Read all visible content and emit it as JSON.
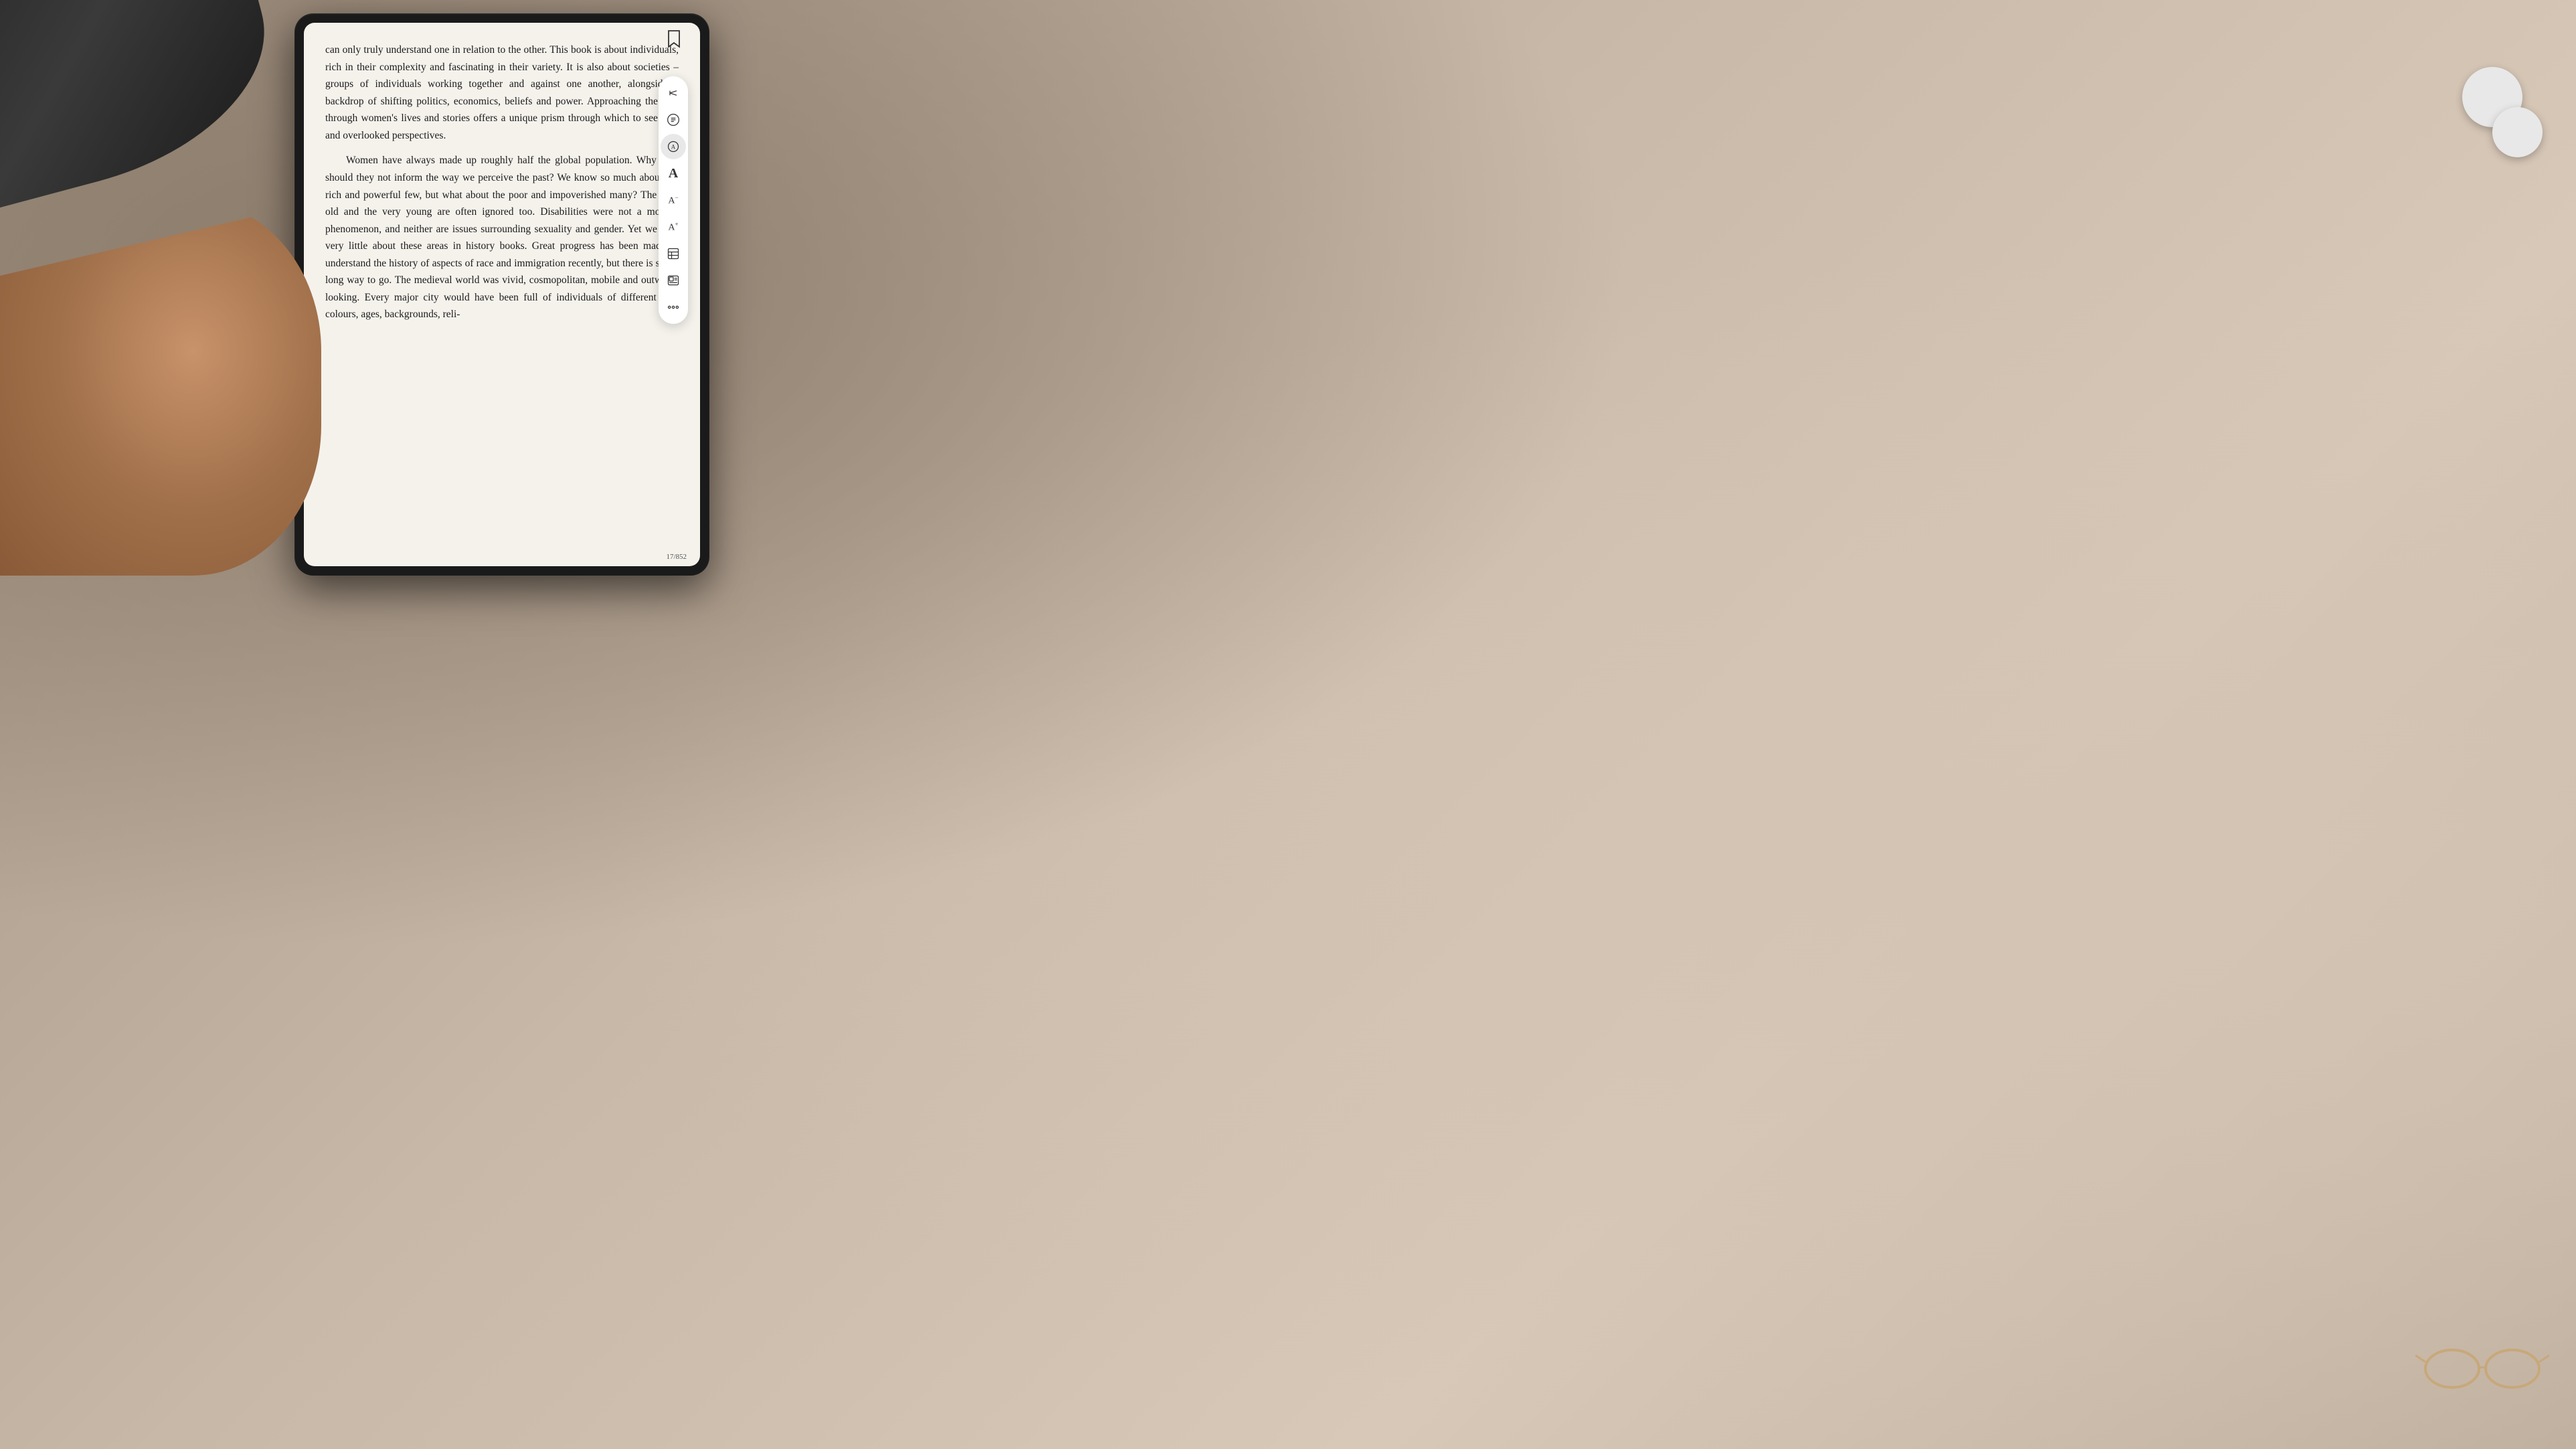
{
  "scene": {
    "background_color": "#c8b8a8"
  },
  "tablet": {
    "page_number": "17/852",
    "bookmark_visible": true
  },
  "book": {
    "paragraph1": "can only truly understand one in relation to the other. This book is about individuals, rich in their complexity and fascinating in their variety. It is also about societies – groups of individuals working together and against one another, alongside a backdrop of shifting politics, economics, beliefs and power. Approaching the past through women's lives and stories offers a unique prism through which to see new and overlooked perspectives.",
    "paragraph2": "Women have always made up roughly half the global population. Why then should they not inform the way we perceive the past? We know so much about the rich and powerful few, but what about the poor and impoverished many? The very old and the very young are often ignored too. Disabilities were not a modern phenomenon, and neither are issues surrounding sexuality and gender. Yet we read very little about these areas in history books. Great progress has been made to understand the history of aspects of race and immigration recently, but there is still a long way to go. The medieval world was vivid, cosmopolitan, mobile and outward-looking. Every major city would have been full of individuals of different skin colours, ages, backgrounds, reli-"
  },
  "toolbar": {
    "items": [
      {
        "id": "collapse",
        "icon": "columns",
        "label": "Collapse toolbar",
        "active": false
      },
      {
        "id": "toc",
        "icon": "list",
        "label": "Table of contents",
        "active": false
      },
      {
        "id": "search",
        "icon": "search",
        "label": "Search",
        "active": true
      },
      {
        "id": "font-large",
        "icon": "A-large",
        "label": "Increase font size",
        "active": false
      },
      {
        "id": "font-small",
        "icon": "A-small",
        "label": "Decrease font size",
        "active": false
      },
      {
        "id": "font-increase",
        "icon": "A-plus",
        "label": "Font increase",
        "active": false
      },
      {
        "id": "layout",
        "icon": "layout",
        "label": "Layout options",
        "active": false
      },
      {
        "id": "image-text",
        "icon": "image-text",
        "label": "Image and text",
        "active": false
      },
      {
        "id": "more",
        "icon": "ellipsis",
        "label": "More options",
        "active": false
      }
    ]
  }
}
